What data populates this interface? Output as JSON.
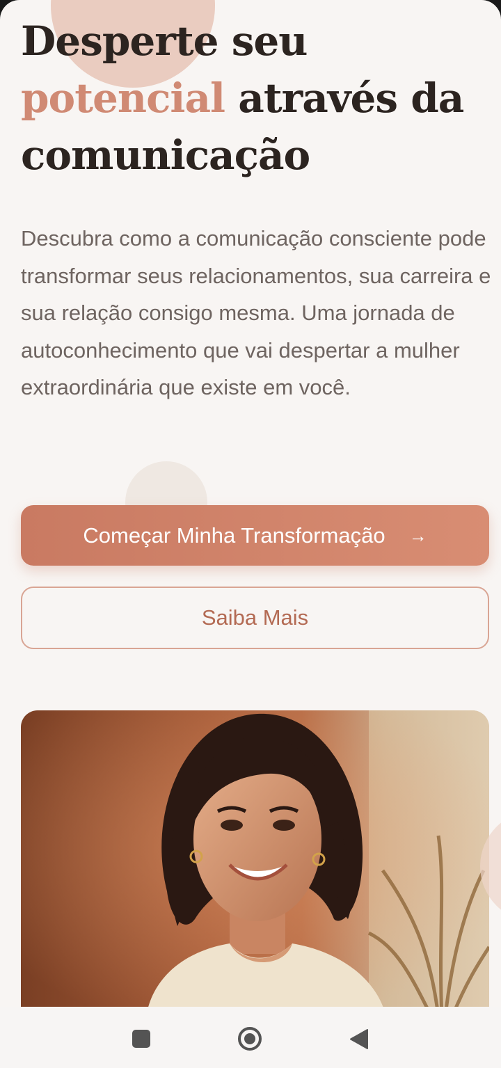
{
  "hero": {
    "headline_part1": "Desperte seu ",
    "headline_accent": "potencial",
    "headline_part2": " através da comunicação",
    "description": "Descubra como a comunicação consciente pode transformar seus relacionamentos, sua carreira e sua relação consigo mesma. Uma jornada de autoconhecimento que vai despertar a mulher extraordinária que existe em você."
  },
  "buttons": {
    "primary_label": "Começar Minha Transformação",
    "primary_icon": "arrow-right-icon",
    "secondary_label": "Saiba Mais"
  },
  "image": {
    "alt": "smiling-woman-portrait"
  },
  "navbar": {
    "recent_icon": "square-icon",
    "home_icon": "circle-home-icon",
    "back_icon": "triangle-back-icon"
  },
  "colors": {
    "accent": "#d08a74",
    "primary_button": "#c97a62",
    "secondary_button_text": "#b36a53",
    "heading_text": "#2c2420",
    "body_text": "#6e6460",
    "background": "#f8f5f3"
  }
}
